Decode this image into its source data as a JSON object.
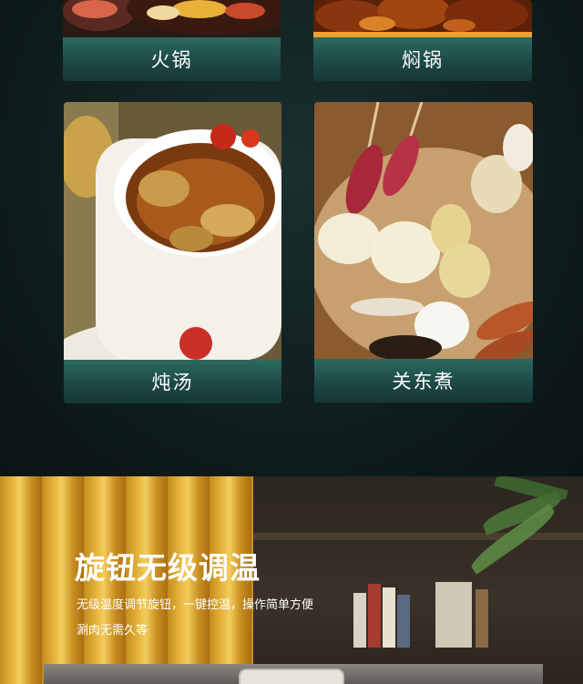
{
  "categories": [
    {
      "label": "火锅"
    },
    {
      "label": "焖锅"
    },
    {
      "label": "炖汤"
    },
    {
      "label": "关东煮"
    }
  ],
  "feature": {
    "title": "旋钮无级调温",
    "desc_line1": "无级温度调节旋钮，一键控温，操作简单方便",
    "desc_line2": "涮肉无需久等"
  }
}
